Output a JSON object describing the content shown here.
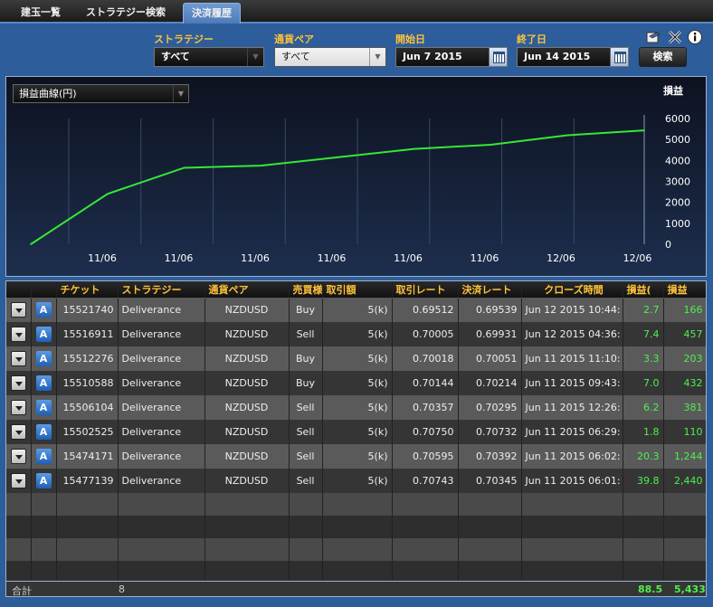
{
  "tabs": [
    "建玉一覧",
    "ストラテジー検索",
    "決済履歴"
  ],
  "filters": {
    "strategy": {
      "label": "ストラテジー",
      "value": "すべて"
    },
    "pair": {
      "label": "通貨ペア",
      "value": "すべて"
    },
    "start": {
      "label": "開始日",
      "value": "Jun 7 2015"
    },
    "end": {
      "label": "終了日",
      "value": "Jun 14 2015"
    },
    "search_label": "検索"
  },
  "chart": {
    "select_value": "損益曲線(円)",
    "ylabel": "損益"
  },
  "chart_data": {
    "type": "line",
    "x": [
      "11/06",
      "11/06",
      "11/06",
      "11/06",
      "11/06",
      "11/06",
      "12/06",
      "12/06"
    ],
    "values": [
      0,
      2400,
      3650,
      3750,
      4150,
      4550,
      4750,
      5200,
      5433
    ],
    "ylim": [
      0,
      6000
    ],
    "yticks": [
      0,
      1000,
      2000,
      3000,
      4000,
      5000,
      6000
    ],
    "ylabel": "損益",
    "grid": true,
    "line_color": "#35e835"
  },
  "table": {
    "headers": [
      "",
      "",
      "チケット",
      "ストラテジー",
      "通貨ペア",
      "売買様",
      "取引額",
      "取引レート",
      "決済レート",
      "クローズ時間",
      "損益(",
      "損益"
    ],
    "rows": [
      [
        "15521740",
        "Deliverance",
        "NZDUSD",
        "Buy",
        "5(k)",
        "0.69512",
        "0.69539",
        "Jun 12 2015 10:44:",
        "2.7",
        "166"
      ],
      [
        "15516911",
        "Deliverance",
        "NZDUSD",
        "Sell",
        "5(k)",
        "0.70005",
        "0.69931",
        "Jun 12 2015 04:36:",
        "7.4",
        "457"
      ],
      [
        "15512276",
        "Deliverance",
        "NZDUSD",
        "Buy",
        "5(k)",
        "0.70018",
        "0.70051",
        "Jun 11 2015 11:10:",
        "3.3",
        "203"
      ],
      [
        "15510588",
        "Deliverance",
        "NZDUSD",
        "Buy",
        "5(k)",
        "0.70144",
        "0.70214",
        "Jun 11 2015 09:43:",
        "7.0",
        "432"
      ],
      [
        "15506104",
        "Deliverance",
        "NZDUSD",
        "Sell",
        "5(k)",
        "0.70357",
        "0.70295",
        "Jun 11 2015 12:26:",
        "6.2",
        "381"
      ],
      [
        "15502525",
        "Deliverance",
        "NZDUSD",
        "Sell",
        "5(k)",
        "0.70750",
        "0.70732",
        "Jun 11 2015 06:29:",
        "1.8",
        "110"
      ],
      [
        "15474171",
        "Deliverance",
        "NZDUSD",
        "Sell",
        "5(k)",
        "0.70595",
        "0.70392",
        "Jun 11 2015 06:02:",
        "20.3",
        "1,244"
      ],
      [
        "15477139",
        "Deliverance",
        "NZDUSD",
        "Sell",
        "5(k)",
        "0.70743",
        "0.70345",
        "Jun 11 2015 06:01:",
        "39.8",
        "2,440"
      ]
    ],
    "row_button_a": "A"
  },
  "footer": {
    "label": "合計",
    "count": "8",
    "pips_total": "88.5",
    "profit_total": "5,433"
  }
}
